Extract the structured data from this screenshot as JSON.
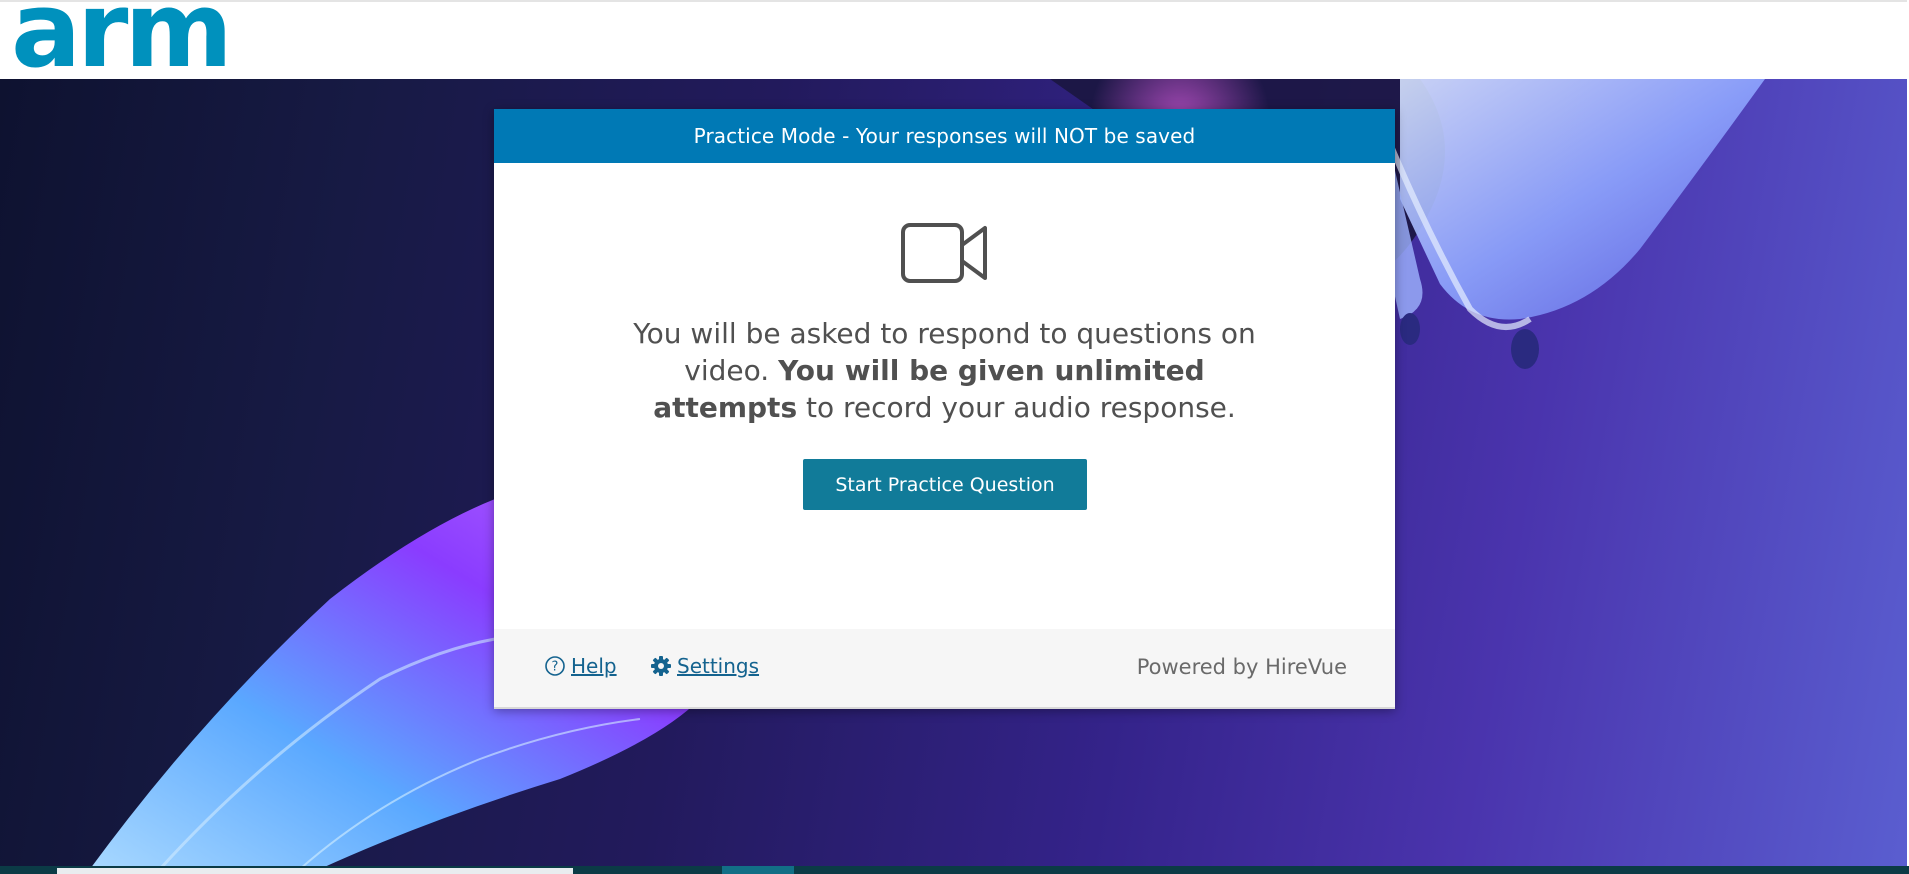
{
  "brand": {
    "logo_text": "arm",
    "color": "#0091bd"
  },
  "modal": {
    "banner": "Practice Mode - Your responses will NOT be saved",
    "icon": "video-camera-icon",
    "message_part1": "You will be asked to respond to questions on video. ",
    "message_bold": "You will be given unlimited attempts",
    "message_part2": " to record your audio response.",
    "start_button_label": "Start Practice Question"
  },
  "footer": {
    "help_label": "Help",
    "help_icon": "question-circle-icon",
    "settings_label": "Settings",
    "settings_icon": "gear-icon",
    "powered_by": "Powered by HireVue"
  },
  "colors": {
    "banner": "#0079b5",
    "button": "#117b99",
    "link": "#14638f"
  }
}
